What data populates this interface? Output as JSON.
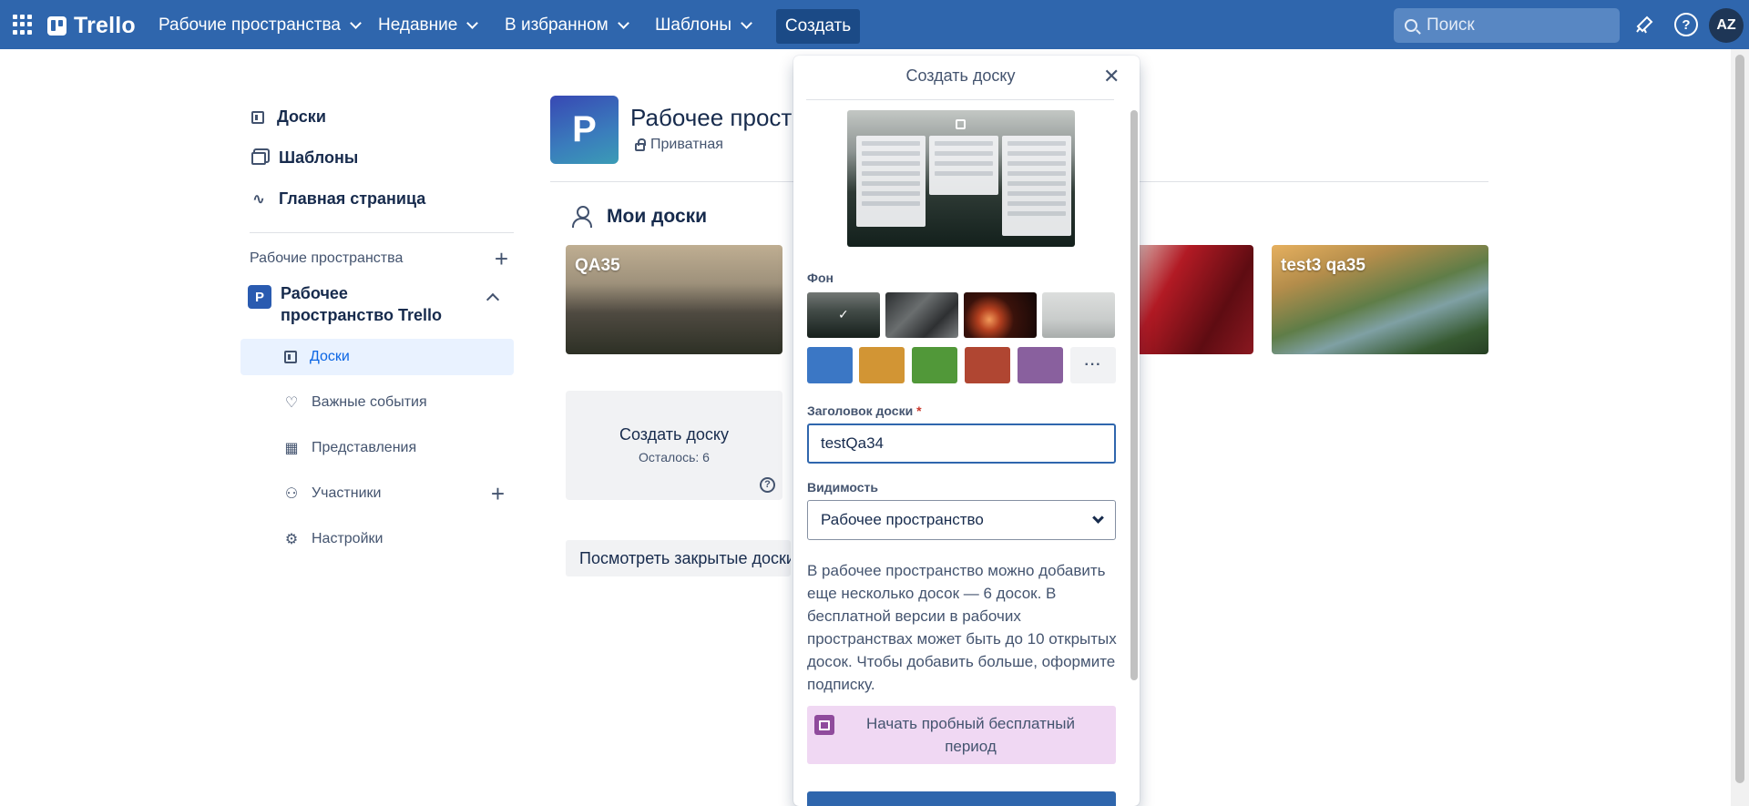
{
  "header": {
    "logo_text": "Trello",
    "nav": [
      {
        "label": "Рабочие пространства"
      },
      {
        "label": "Недавние"
      },
      {
        "label": "В избранном"
      },
      {
        "label": "Шаблоны"
      }
    ],
    "create_label": "Создать",
    "search_placeholder": "Поиск",
    "avatar_initials": "AZ",
    "brand_color": "#2f66ad"
  },
  "sidebar": {
    "top_items": [
      {
        "label": "Доски",
        "icon": "board-icon"
      },
      {
        "label": "Шаблоны",
        "icon": "template-icon"
      },
      {
        "label": "Главная страница",
        "icon": "pulse-icon"
      }
    ],
    "workspaces_heading": "Рабочие пространства",
    "workspace": {
      "badge": "P",
      "name": "Рабочее пространство Trello"
    },
    "sub_items": [
      {
        "label": "Доски",
        "icon": "board-icon",
        "active": true
      },
      {
        "label": "Важные события",
        "icon": "heart-icon"
      },
      {
        "label": "Представления",
        "icon": "grid-icon"
      },
      {
        "label": "Участники",
        "icon": "members-icon"
      },
      {
        "label": "Настройки",
        "icon": "gear-icon"
      }
    ]
  },
  "main": {
    "workspace_badge": "P",
    "workspace_title": "Рабочее пространство Trello",
    "visibility": "Приватная",
    "my_boards_heading": "Мои доски",
    "boards": [
      {
        "title": "QA35"
      },
      {
        "title": ""
      },
      {
        "title": "test3 qa35"
      }
    ],
    "create_board": {
      "title": "Создать доску",
      "remaining": "Осталось: 6"
    },
    "closed_boards_label": "Посмотреть закрытые доски"
  },
  "popover": {
    "title": "Создать доску",
    "background_label": "Фон",
    "background_colors": [
      "#3b77c5",
      "#d29534",
      "#519839",
      "#b04632",
      "#89609e"
    ],
    "more_label": "···",
    "board_title_label": "Заголовок доски",
    "required_mark": "*",
    "board_title_value": "testQa34",
    "visibility_label": "Видимость",
    "visibility_value": "Рабочее пространство",
    "info_text": "В рабочее пространство можно добавить еще несколько досок — 6 досок. В бесплатной версии в рабочих пространствах может быть до 10 открытых досок. Чтобы добавить больше, оформите подписку.",
    "trial_label": "Начать пробный бесплатный период"
  }
}
